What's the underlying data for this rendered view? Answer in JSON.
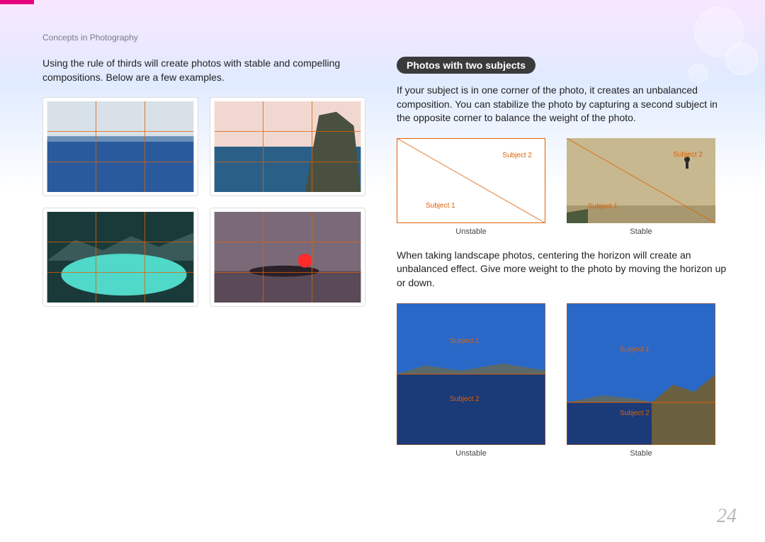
{
  "header": "Concepts in Photography",
  "left": {
    "intro": "Using the rule of thirds will create photos with stable and compelling compositions. Below are a few examples."
  },
  "right": {
    "sectionTitle": "Photos with two subjects",
    "para1": "If your subject is in one corner of the photo, it creates an unbalanced composition. You can stabilize the photo by capturing a second subject in the opposite corner to balance the weight of the photo.",
    "diagram1": {
      "subject1": "Subject 1",
      "subject2": "Subject 2",
      "captionA": "Unstable",
      "captionB": "Stable"
    },
    "para2": "When taking landscape photos, centering the horizon will create an unbalanced effect. Give more weight to the photo by moving the horizon up or down.",
    "diagram2": {
      "subject1": "Subject 1",
      "subject2": "Subject 2",
      "captionA": "Unstable",
      "captionB": "Stable"
    }
  },
  "pageNumber": "24"
}
